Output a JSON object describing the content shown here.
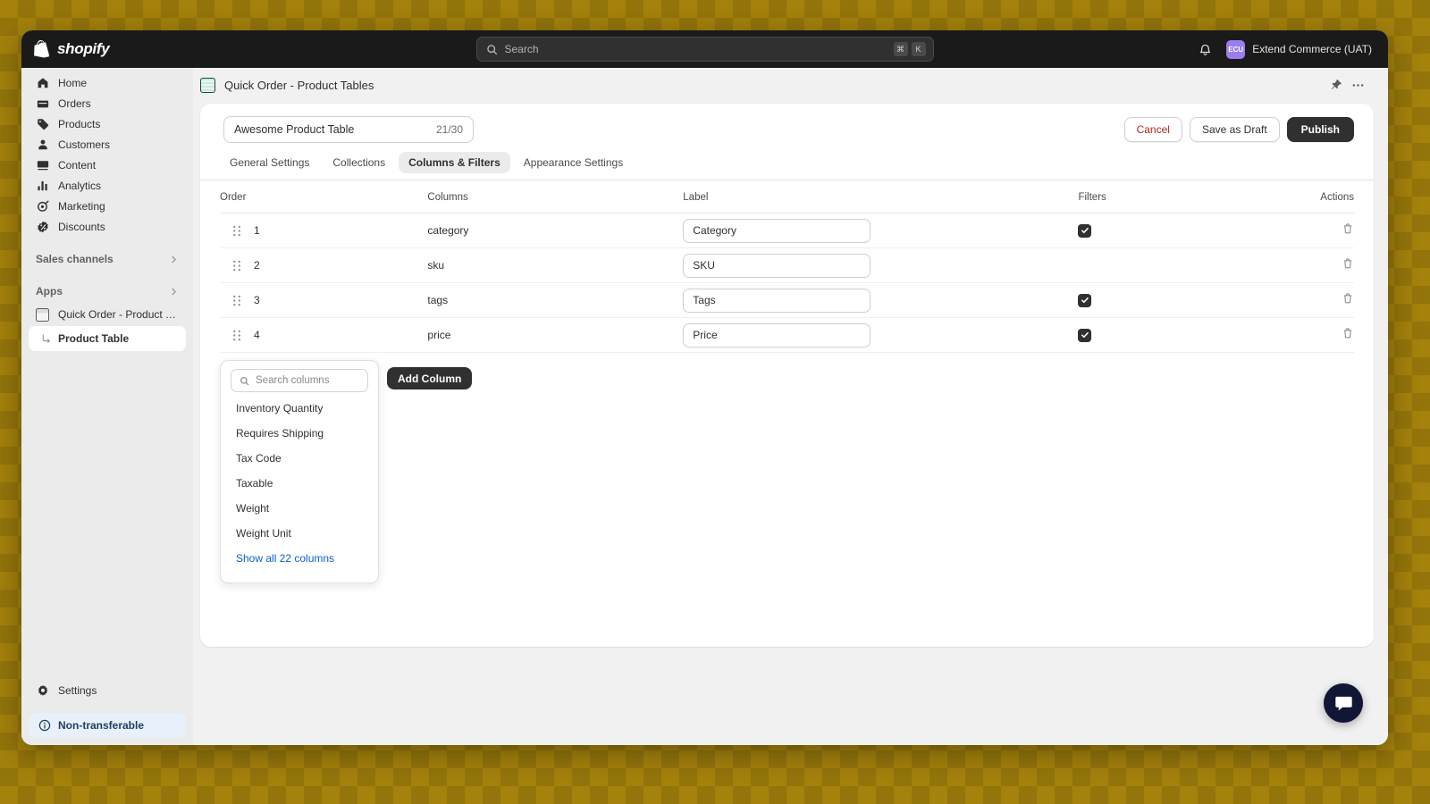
{
  "topbar": {
    "brand": "shopify",
    "search": {
      "placeholder": "Search",
      "shortcut_key1": "⌘",
      "shortcut_key2": "K"
    },
    "notifications_icon": "bell-icon",
    "account": {
      "initials": "ECU",
      "name": "Extend Commerce (UAT)"
    }
  },
  "sidebar": {
    "items": [
      {
        "label": "Home",
        "icon": "home-icon"
      },
      {
        "label": "Orders",
        "icon": "orders-icon"
      },
      {
        "label": "Products",
        "icon": "tag-icon"
      },
      {
        "label": "Customers",
        "icon": "person-icon"
      },
      {
        "label": "Content",
        "icon": "content-icon"
      },
      {
        "label": "Analytics",
        "icon": "bar-chart-icon"
      },
      {
        "label": "Marketing",
        "icon": "target-icon"
      },
      {
        "label": "Discounts",
        "icon": "discount-icon"
      }
    ],
    "sections": [
      {
        "label": "Sales channels"
      },
      {
        "label": "Apps"
      }
    ],
    "app": {
      "label": "Quick Order - Product Tab...",
      "icon": "app-table-icon"
    },
    "app_sub": {
      "label": "Product Table"
    },
    "settings": {
      "label": "Settings",
      "icon": "gear-icon"
    },
    "notice": {
      "label": "Non-transferable",
      "icon": "info-icon"
    }
  },
  "page": {
    "title": "Quick Order - Product Tables",
    "icon": "spreadsheet-icon",
    "pin_icon": "pin-icon",
    "more_icon": "ellipsis-icon"
  },
  "card": {
    "title_input": {
      "value": "Awesome Product Table",
      "counter": "21/30"
    },
    "actions": {
      "cancel": "Cancel",
      "save_draft": "Save as Draft",
      "publish": "Publish"
    },
    "tabs": [
      {
        "label": "General Settings",
        "active": false
      },
      {
        "label": "Collections",
        "active": false
      },
      {
        "label": "Columns & Filters",
        "active": true
      },
      {
        "label": "Appearance Settings",
        "active": false
      }
    ],
    "table": {
      "headers": [
        "Order",
        "Columns",
        "Label",
        "Filters",
        "Actions"
      ],
      "rows": [
        {
          "order": "1",
          "column": "category",
          "label": "Category",
          "filter": true,
          "action_icon": "trash-icon"
        },
        {
          "order": "2",
          "column": "sku",
          "label": "SKU",
          "filter": false,
          "action_icon": "trash-icon"
        },
        {
          "order": "3",
          "column": "tags",
          "label": "Tags",
          "filter": true,
          "action_icon": "trash-icon"
        },
        {
          "order": "4",
          "column": "price",
          "label": "Price",
          "filter": true,
          "action_icon": "trash-icon"
        }
      ]
    },
    "popover": {
      "search_placeholder": "Search columns",
      "items": [
        "Inventory Quantity",
        "Requires Shipping",
        "Tax Code",
        "Taxable",
        "Weight",
        "Weight Unit"
      ],
      "show_all_link": "Show all 22 columns"
    },
    "add_column_button": "Add Column"
  },
  "chat": {
    "icon": "chat-bubble-icon"
  },
  "colors": {
    "desktop_background": "#a5820c",
    "topbar": "#1a1a1a",
    "sidebar": "#ebebeb",
    "accent_primary": "#303030",
    "avatar": "#9b7dee",
    "link": "#0b5fce",
    "danger": "#b02a1c",
    "notice_background": "#e8f1fb",
    "chat_fab": "#111536"
  }
}
